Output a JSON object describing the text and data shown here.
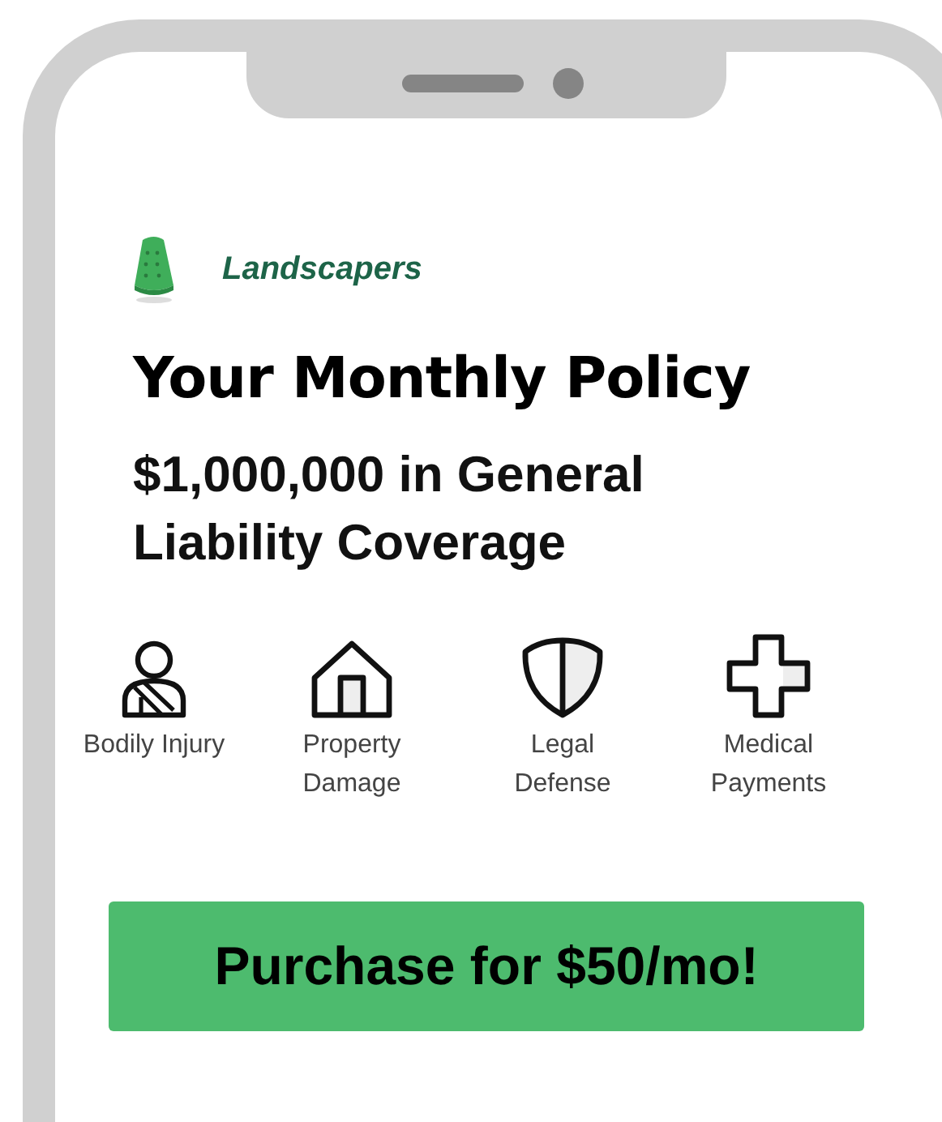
{
  "category": {
    "label": "Landscapers"
  },
  "title": "Your Monthly Policy",
  "subtitle": "$1,000,000 in General Liability Coverage",
  "coverages": [
    {
      "kind": "person",
      "label": "Bodily Injury"
    },
    {
      "kind": "house",
      "label": "Property Damage"
    },
    {
      "kind": "shield",
      "label": "Legal Defense"
    },
    {
      "kind": "cross",
      "label": "Medical Payments"
    }
  ],
  "button": {
    "label": "Purchase for $50/mo!"
  }
}
